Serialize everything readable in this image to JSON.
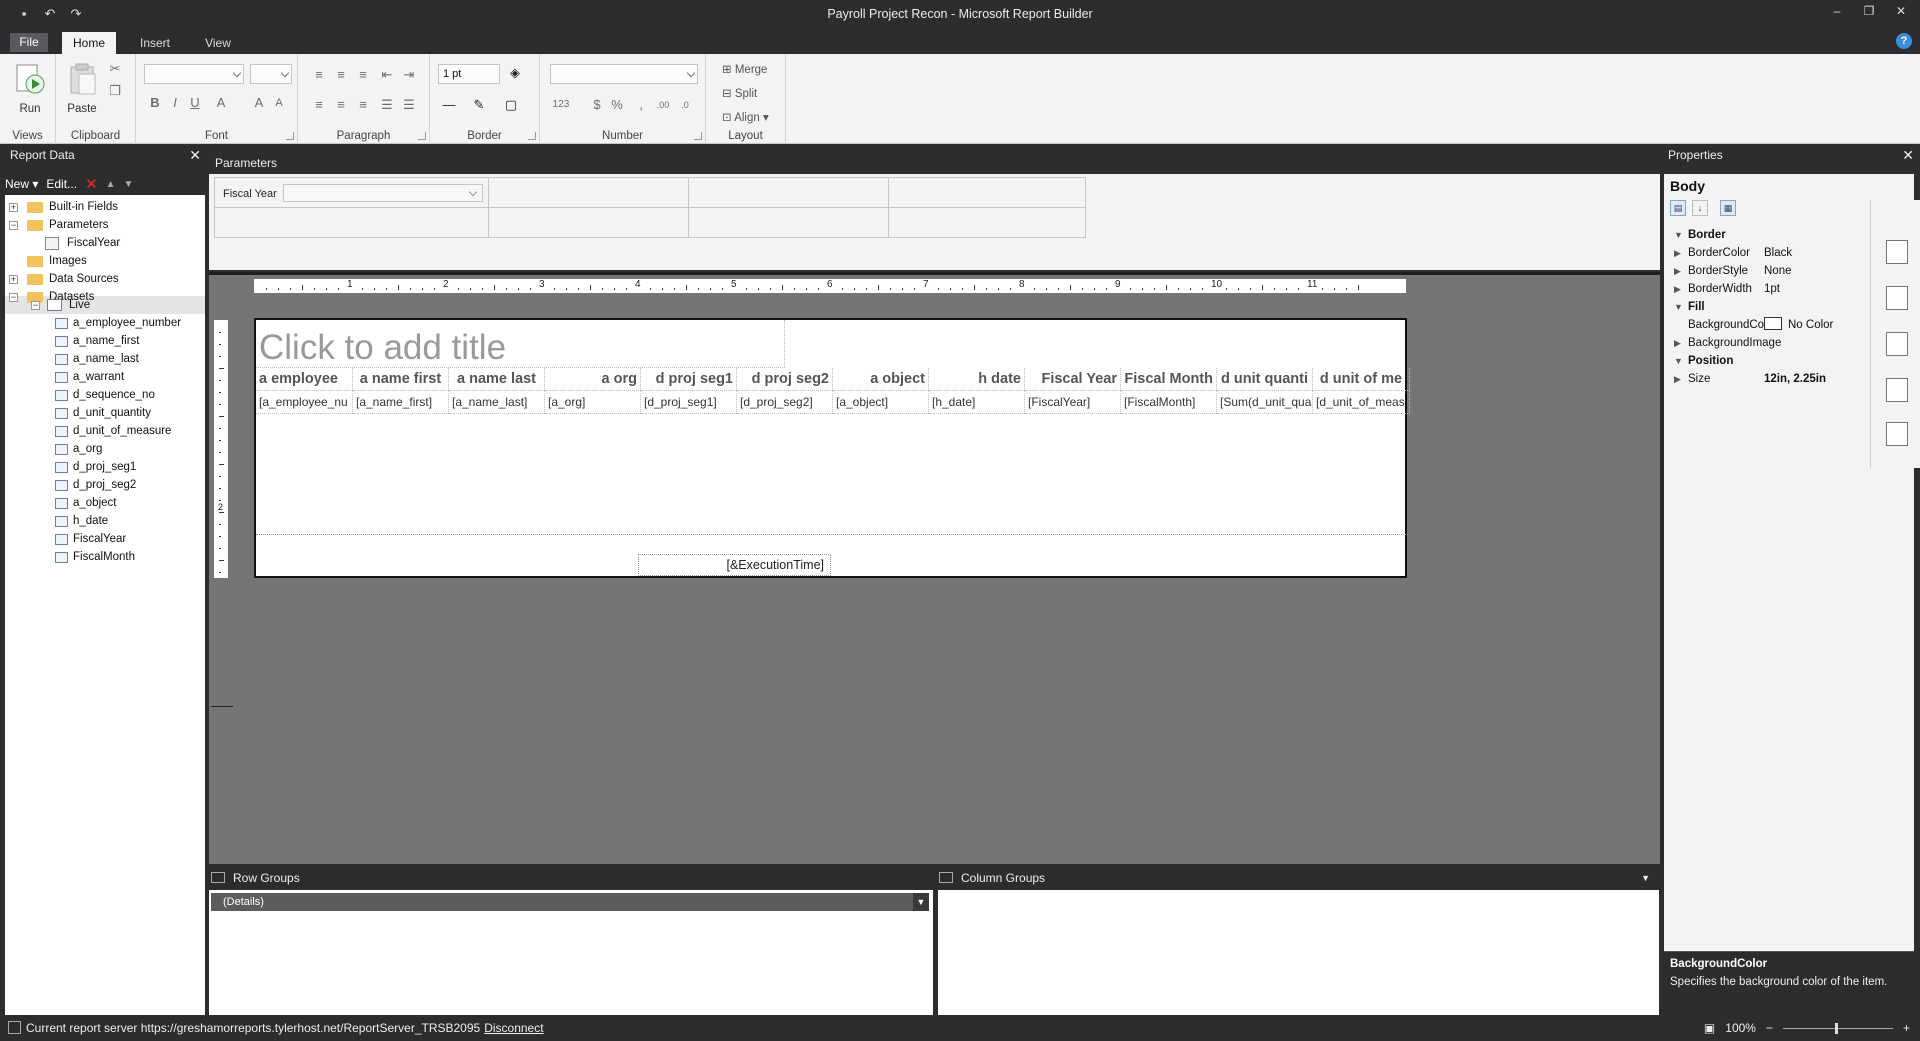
{
  "window": {
    "title": "Payroll Project Recon - Microsoft Report Builder"
  },
  "tabs": [
    {
      "label": "File"
    },
    {
      "label": "Home"
    },
    {
      "label": "Insert"
    },
    {
      "label": "View"
    }
  ],
  "ribbon": {
    "run_label": "Run",
    "paste_label": "Paste",
    "border_width_value": "1 pt",
    "merge_label": "Merge",
    "split_label": "Split",
    "align_label": "Align",
    "groups": {
      "views": "Views",
      "clipboard": "Clipboard",
      "font": "Font",
      "paragraph": "Paragraph",
      "border": "Border",
      "number": "Number",
      "layout": "Layout"
    }
  },
  "report_data": {
    "title": "Report Data",
    "new_label": "New",
    "edit_label": "Edit...",
    "tree": [
      {
        "label": "Built-in Fields"
      },
      {
        "label": "Parameters"
      },
      {
        "label": "FiscalYear"
      },
      {
        "label": "Images"
      },
      {
        "label": "Data Sources"
      },
      {
        "label": "Datasets"
      },
      {
        "label": "Live"
      }
    ],
    "fields": [
      "a_employee_number",
      "a_name_first",
      "a_name_last",
      "a_warrant",
      "d_sequence_no",
      "d_unit_quantity",
      "d_unit_of_measure",
      "a_org",
      "d_proj_seg1",
      "d_proj_seg2",
      "a_object",
      "h_date",
      "FiscalYear",
      "FiscalMonth"
    ]
  },
  "parameters": {
    "title": "Parameters",
    "fiscal_year_label": "Fiscal Year"
  },
  "report": {
    "title_placeholder": "Click to add title",
    "headers": [
      "a employee",
      "a name first",
      "a name last",
      "a org",
      "d proj seg1",
      "d proj seg2",
      "a object",
      "h date",
      "Fiscal Year",
      "Fiscal Month",
      "d unit quanti",
      "d unit of me"
    ],
    "details": [
      "[a_employee_nu",
      "[a_name_first]",
      "[a_name_last]",
      "[a_org]",
      "[d_proj_seg1]",
      "[d_proj_seg2]",
      "[a_object]",
      "[h_date]",
      "[FiscalYear]",
      "[FiscalMonth]",
      "[Sum(d_unit_qua",
      "[d_unit_of_meas"
    ],
    "execution_time": "[&ExecutionTime]",
    "ruler_numbers": [
      "1",
      "2",
      "3",
      "4",
      "5",
      "6",
      "7",
      "8",
      "9",
      "10",
      "11"
    ],
    "vruler_number": "2"
  },
  "groups": {
    "row_groups_title": "Row Groups",
    "column_groups_title": "Column Groups",
    "details_label": "(Details)"
  },
  "properties": {
    "title": "Properties",
    "object": "Body",
    "rows": [
      {
        "name": "Border"
      },
      {
        "name": "BorderColor",
        "value": "Black"
      },
      {
        "name": "BorderStyle",
        "value": "None"
      },
      {
        "name": "BorderWidth",
        "value": "1pt"
      },
      {
        "name": "Fill"
      },
      {
        "name": "BackgroundColor",
        "value": "No Color"
      },
      {
        "name": "BackgroundImage"
      },
      {
        "name": "Position"
      },
      {
        "name": "Size",
        "value": "12in, 2.25in"
      }
    ],
    "desc_title": "BackgroundColor",
    "desc_text": "Specifies the background color of the item."
  },
  "status": {
    "text": "Current report server https://greshamorreports.tylerhost.net/ReportServer_TRSB2095",
    "disconnect": "Disconnect",
    "zoom": "100%"
  }
}
